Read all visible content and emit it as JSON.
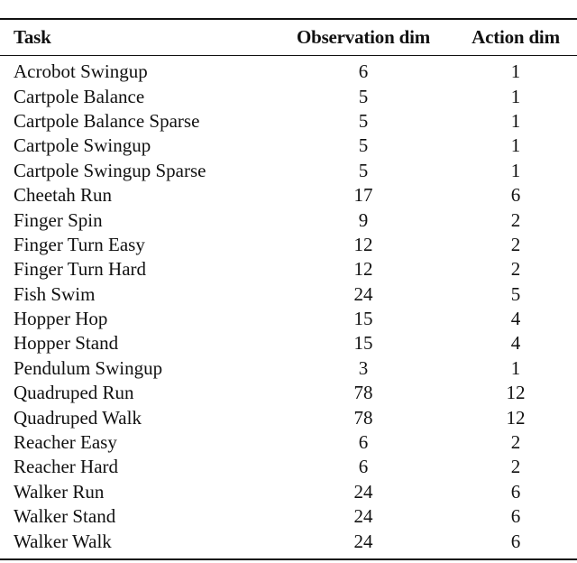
{
  "table": {
    "columns": [
      "Task",
      "Observation dim",
      "Action dim"
    ],
    "rows": [
      {
        "task": "Acrobot Swingup",
        "obs": "6",
        "act": "1"
      },
      {
        "task": "Cartpole Balance",
        "obs": "5",
        "act": "1"
      },
      {
        "task": "Cartpole Balance Sparse",
        "obs": "5",
        "act": "1"
      },
      {
        "task": "Cartpole Swingup",
        "obs": "5",
        "act": "1"
      },
      {
        "task": "Cartpole Swingup Sparse",
        "obs": "5",
        "act": "1"
      },
      {
        "task": "Cheetah Run",
        "obs": "17",
        "act": "6"
      },
      {
        "task": "Finger Spin",
        "obs": "9",
        "act": "2"
      },
      {
        "task": "Finger Turn Easy",
        "obs": "12",
        "act": "2"
      },
      {
        "task": "Finger Turn Hard",
        "obs": "12",
        "act": "2"
      },
      {
        "task": "Fish Swim",
        "obs": "24",
        "act": "5"
      },
      {
        "task": "Hopper Hop",
        "obs": "15",
        "act": "4"
      },
      {
        "task": "Hopper Stand",
        "obs": "15",
        "act": "4"
      },
      {
        "task": "Pendulum Swingup",
        "obs": "3",
        "act": "1"
      },
      {
        "task": "Quadruped Run",
        "obs": "78",
        "act": "12"
      },
      {
        "task": "Quadruped Walk",
        "obs": "78",
        "act": "12"
      },
      {
        "task": "Reacher Easy",
        "obs": "6",
        "act": "2"
      },
      {
        "task": "Reacher Hard",
        "obs": "6",
        "act": "2"
      },
      {
        "task": "Walker Run",
        "obs": "24",
        "act": "6"
      },
      {
        "task": "Walker Stand",
        "obs": "24",
        "act": "6"
      },
      {
        "task": "Walker Walk",
        "obs": "24",
        "act": "6"
      }
    ]
  }
}
